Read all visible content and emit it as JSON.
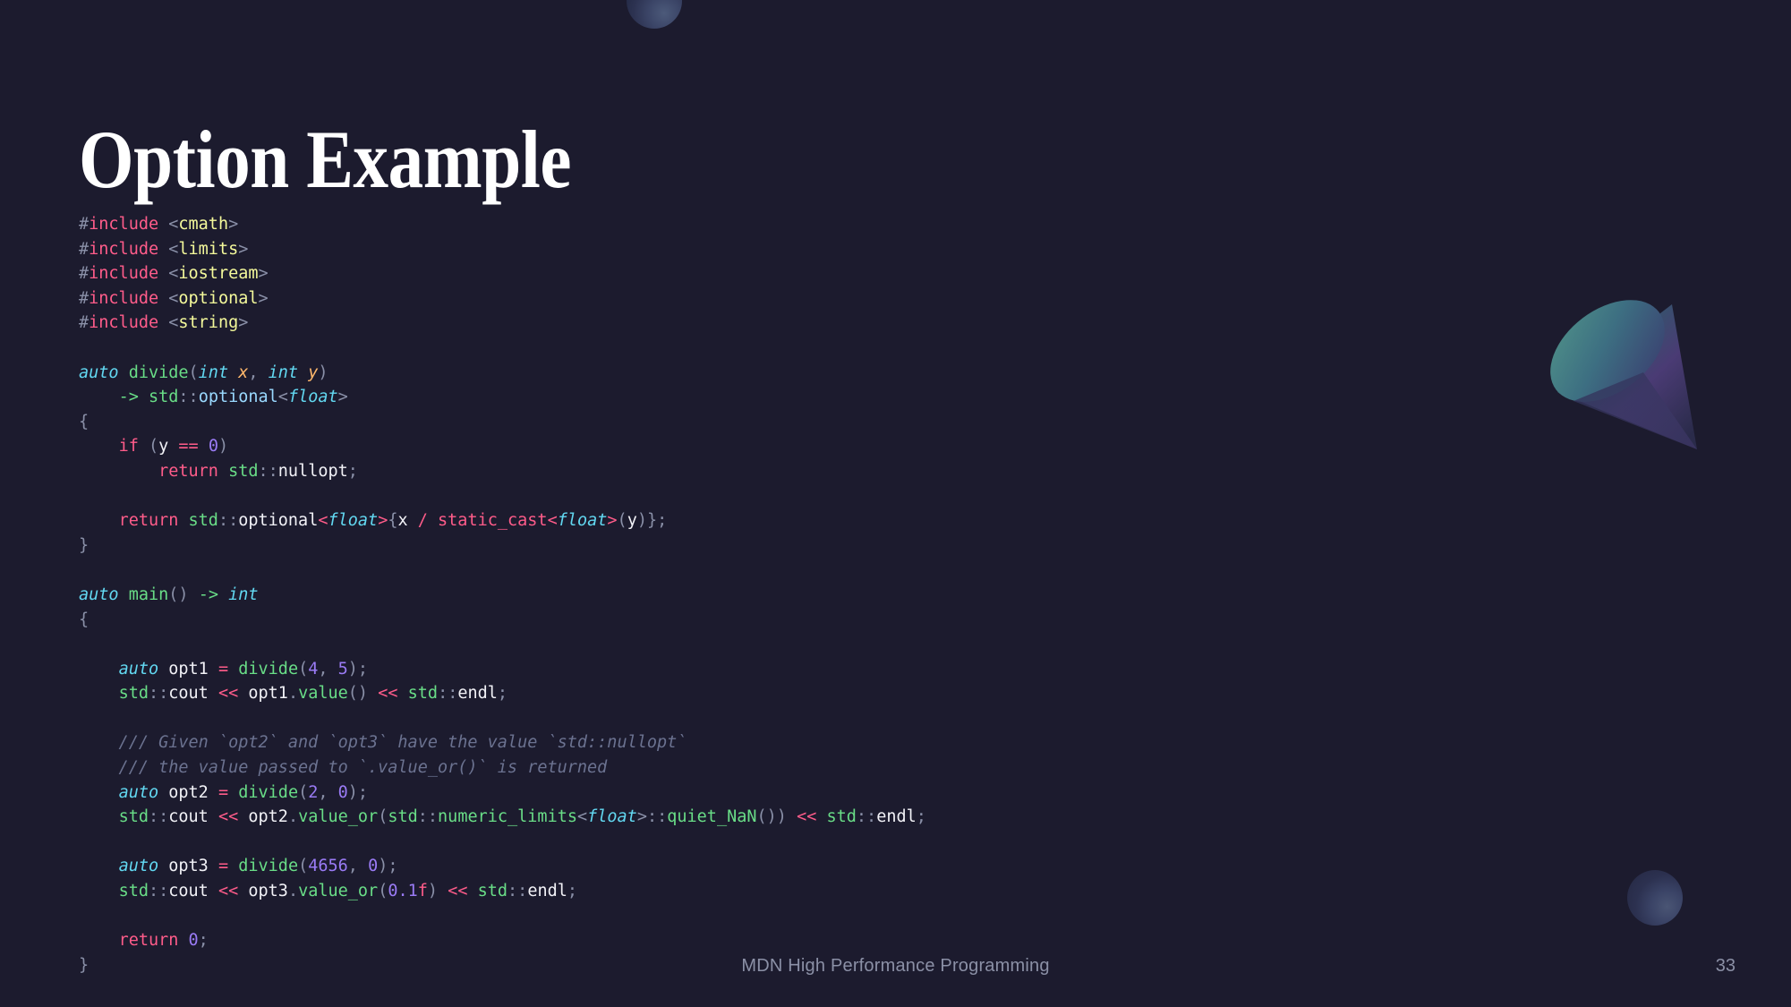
{
  "slide": {
    "title": "Option Example",
    "footer": "MDN High Performance Programming",
    "page_number": "33",
    "background_color": "#1c1b2e",
    "title_color": "#ffffff",
    "footer_color": "#8b90a6"
  },
  "decorations": [
    {
      "name": "sphere-top",
      "shape": "sphere"
    },
    {
      "name": "cone",
      "shape": "cone"
    },
    {
      "name": "sphere-bottom",
      "shape": "sphere"
    }
  ],
  "code": {
    "language": "cpp",
    "theme_colors": {
      "keyword": "#ff5c8a",
      "preprocessor_hash": "#8a90a8",
      "header_name": "#f4f99b",
      "type": "#62d8f1",
      "function": "#69dd87",
      "parameter": "#ffb86c",
      "identifier": "#f2f2f7",
      "number": "#9a7bf5",
      "comment": "#6b7290",
      "punctuation": "#a9afc4"
    },
    "text": "#include <cmath>\n#include <limits>\n#include <iostream>\n#include <optional>\n#include <string>\n\nauto divide(int x, int y)\n    -> std::optional<float>\n{\n    if (y == 0)\n        return std::nullopt;\n\n    return std::optional<float>{x / static_cast<float>(y)};\n}\n\nauto main() -> int\n{\n\n    auto opt1 = divide(4, 5);\n    std::cout << opt1.value() << std::endl;\n\n    /// Given `opt2` and `opt3` have the value `std::nullopt`\n    /// the value passed to `.value_or()` is returned\n    auto opt2 = divide(2, 0);\n    std::cout << opt2.value_or(std::numeric_limits<float>::quiet_NaN()) << std::endl;\n\n    auto opt3 = divide(4656, 0);\n    std::cout << opt3.value_or(0.1f) << std::endl;\n\n    return 0;\n}",
    "lines": [
      {
        "n": 1,
        "plain": "#include <cmath>"
      },
      {
        "n": 2,
        "plain": "#include <limits>"
      },
      {
        "n": 3,
        "plain": "#include <iostream>"
      },
      {
        "n": 4,
        "plain": "#include <optional>"
      },
      {
        "n": 5,
        "plain": "#include <string>"
      },
      {
        "n": 6,
        "plain": ""
      },
      {
        "n": 7,
        "plain": "auto divide(int x, int y)"
      },
      {
        "n": 8,
        "plain": "    -> std::optional<float>"
      },
      {
        "n": 9,
        "plain": "{"
      },
      {
        "n": 10,
        "plain": "    if (y == 0)"
      },
      {
        "n": 11,
        "plain": "        return std::nullopt;"
      },
      {
        "n": 12,
        "plain": ""
      },
      {
        "n": 13,
        "plain": "    return std::optional<float>{x / static_cast<float>(y)};"
      },
      {
        "n": 14,
        "plain": "}"
      },
      {
        "n": 15,
        "plain": ""
      },
      {
        "n": 16,
        "plain": "auto main() -> int"
      },
      {
        "n": 17,
        "plain": "{"
      },
      {
        "n": 18,
        "plain": ""
      },
      {
        "n": 19,
        "plain": "    auto opt1 = divide(4, 5);"
      },
      {
        "n": 20,
        "plain": "    std::cout << opt1.value() << std::endl;"
      },
      {
        "n": 21,
        "plain": ""
      },
      {
        "n": 22,
        "plain": "    /// Given `opt2` and `opt3` have the value `std::nullopt`"
      },
      {
        "n": 23,
        "plain": "    /// the value passed to `.value_or()` is returned"
      },
      {
        "n": 24,
        "plain": "    auto opt2 = divide(2, 0);"
      },
      {
        "n": 25,
        "plain": "    std::cout << opt2.value_or(std::numeric_limits<float>::quiet_NaN()) << std::endl;"
      },
      {
        "n": 26,
        "plain": ""
      },
      {
        "n": 27,
        "plain": "    auto opt3 = divide(4656, 0);"
      },
      {
        "n": 28,
        "plain": "    std::cout << opt3.value_or(0.1f) << std::endl;"
      },
      {
        "n": 29,
        "plain": ""
      },
      {
        "n": 30,
        "plain": "    return 0;"
      },
      {
        "n": 31,
        "plain": "}"
      }
    ],
    "tokens": [
      [
        [
          "#",
          "hash"
        ],
        [
          "include",
          "pink"
        ],
        [
          " ",
          "plain"
        ],
        [
          "<",
          "gray"
        ],
        [
          "cmath",
          "yellow"
        ],
        [
          ">",
          "gray"
        ]
      ],
      [
        [
          "#",
          "hash"
        ],
        [
          "include",
          "pink"
        ],
        [
          " ",
          "plain"
        ],
        [
          "<",
          "gray"
        ],
        [
          "limits",
          "yellow"
        ],
        [
          ">",
          "gray"
        ]
      ],
      [
        [
          "#",
          "hash"
        ],
        [
          "include",
          "pink"
        ],
        [
          " ",
          "plain"
        ],
        [
          "<",
          "gray"
        ],
        [
          "iostream",
          "yellow"
        ],
        [
          ">",
          "gray"
        ]
      ],
      [
        [
          "#",
          "hash"
        ],
        [
          "include",
          "pink"
        ],
        [
          " ",
          "plain"
        ],
        [
          "<",
          "gray"
        ],
        [
          "optional",
          "yellow"
        ],
        [
          ">",
          "gray"
        ]
      ],
      [
        [
          "#",
          "hash"
        ],
        [
          "include",
          "pink"
        ],
        [
          " ",
          "plain"
        ],
        [
          "<",
          "gray"
        ],
        [
          "string",
          "yellow"
        ],
        [
          ">",
          "gray"
        ]
      ],
      [],
      [
        [
          "auto",
          "cyan"
        ],
        [
          " ",
          "plain"
        ],
        [
          "divide",
          "green"
        ],
        [
          "(",
          "gray"
        ],
        [
          "int",
          "cyan"
        ],
        [
          " ",
          "plain"
        ],
        [
          "x",
          "orange"
        ],
        [
          ", ",
          "gray"
        ],
        [
          "int",
          "cyan"
        ],
        [
          " ",
          "plain"
        ],
        [
          "y",
          "orange"
        ],
        [
          ")",
          "gray"
        ]
      ],
      [
        [
          "    ",
          "plain"
        ],
        [
          "->",
          "green"
        ],
        [
          " ",
          "plain"
        ],
        [
          "std",
          "green"
        ],
        [
          "::",
          "gray"
        ],
        [
          "optional",
          "blue"
        ],
        [
          "<",
          "gray"
        ],
        [
          "float",
          "cyan"
        ],
        [
          ">",
          "gray"
        ]
      ],
      [
        [
          "{",
          "gray"
        ]
      ],
      [
        [
          "    ",
          "plain"
        ],
        [
          "if",
          "pink"
        ],
        [
          " ",
          "plain"
        ],
        [
          "(",
          "gray"
        ],
        [
          "y",
          "white"
        ],
        [
          " ",
          "plain"
        ],
        [
          "==",
          "pink"
        ],
        [
          " ",
          "plain"
        ],
        [
          "0",
          "purple"
        ],
        [
          ")",
          "gray"
        ]
      ],
      [
        [
          "        ",
          "plain"
        ],
        [
          "return",
          "pink"
        ],
        [
          " ",
          "plain"
        ],
        [
          "std",
          "green"
        ],
        [
          "::",
          "gray"
        ],
        [
          "nullopt",
          "white"
        ],
        [
          ";",
          "gray"
        ]
      ],
      [],
      [
        [
          "    ",
          "plain"
        ],
        [
          "return",
          "pink"
        ],
        [
          " ",
          "plain"
        ],
        [
          "std",
          "green"
        ],
        [
          "::",
          "gray"
        ],
        [
          "optional",
          "white"
        ],
        [
          "<",
          "pink"
        ],
        [
          "float",
          "cyan"
        ],
        [
          ">",
          "pink"
        ],
        [
          "{",
          "gray"
        ],
        [
          "x",
          "white"
        ],
        [
          " ",
          "plain"
        ],
        [
          "/",
          "pink"
        ],
        [
          " ",
          "plain"
        ],
        [
          "static_cast",
          "pink"
        ],
        [
          "<",
          "pink"
        ],
        [
          "float",
          "cyan"
        ],
        [
          ">",
          "pink"
        ],
        [
          "(",
          "gray"
        ],
        [
          "y",
          "white"
        ],
        [
          ")};",
          "gray"
        ]
      ],
      [
        [
          "}",
          "gray"
        ]
      ],
      [],
      [
        [
          "auto",
          "cyan"
        ],
        [
          " ",
          "plain"
        ],
        [
          "main",
          "green"
        ],
        [
          "()",
          "gray"
        ],
        [
          " ",
          "plain"
        ],
        [
          "->",
          "green"
        ],
        [
          " ",
          "plain"
        ],
        [
          "int",
          "cyan"
        ]
      ],
      [
        [
          "{",
          "gray"
        ]
      ],
      [],
      [
        [
          "    ",
          "plain"
        ],
        [
          "auto",
          "cyan"
        ],
        [
          " ",
          "plain"
        ],
        [
          "opt1",
          "white"
        ],
        [
          " ",
          "plain"
        ],
        [
          "=",
          "pink"
        ],
        [
          " ",
          "plain"
        ],
        [
          "divide",
          "green"
        ],
        [
          "(",
          "gray"
        ],
        [
          "4",
          "purple"
        ],
        [
          ", ",
          "gray"
        ],
        [
          "5",
          "purple"
        ],
        [
          ");",
          "gray"
        ]
      ],
      [
        [
          "    ",
          "plain"
        ],
        [
          "std",
          "green"
        ],
        [
          "::",
          "gray"
        ],
        [
          "cout",
          "white"
        ],
        [
          " ",
          "plain"
        ],
        [
          "<<",
          "pink"
        ],
        [
          " ",
          "plain"
        ],
        [
          "opt1",
          "white"
        ],
        [
          ".",
          "gray"
        ],
        [
          "value",
          "green"
        ],
        [
          "()",
          "gray"
        ],
        [
          " ",
          "plain"
        ],
        [
          "<<",
          "pink"
        ],
        [
          " ",
          "plain"
        ],
        [
          "std",
          "green"
        ],
        [
          "::",
          "gray"
        ],
        [
          "endl",
          "white"
        ],
        [
          ";",
          "gray"
        ]
      ],
      [],
      [
        [
          "    /// Given `opt2` and `opt3` have the value `std::nullopt`",
          "comment"
        ]
      ],
      [
        [
          "    /// the value passed to `.value_or()` is returned",
          "comment"
        ]
      ],
      [
        [
          "    ",
          "plain"
        ],
        [
          "auto",
          "cyan"
        ],
        [
          " ",
          "plain"
        ],
        [
          "opt2",
          "white"
        ],
        [
          " ",
          "plain"
        ],
        [
          "=",
          "pink"
        ],
        [
          " ",
          "plain"
        ],
        [
          "divide",
          "green"
        ],
        [
          "(",
          "gray"
        ],
        [
          "2",
          "purple"
        ],
        [
          ", ",
          "gray"
        ],
        [
          "0",
          "purple"
        ],
        [
          ");",
          "gray"
        ]
      ],
      [
        [
          "    ",
          "plain"
        ],
        [
          "std",
          "green"
        ],
        [
          "::",
          "gray"
        ],
        [
          "cout",
          "white"
        ],
        [
          " ",
          "plain"
        ],
        [
          "<<",
          "pink"
        ],
        [
          " ",
          "plain"
        ],
        [
          "opt2",
          "white"
        ],
        [
          ".",
          "gray"
        ],
        [
          "value_or",
          "green"
        ],
        [
          "(",
          "gray"
        ],
        [
          "std",
          "green"
        ],
        [
          "::",
          "gray"
        ],
        [
          "numeric_limits",
          "green"
        ],
        [
          "<",
          "gray"
        ],
        [
          "float",
          "cyan"
        ],
        [
          ">",
          "gray"
        ],
        [
          "::",
          "gray"
        ],
        [
          "quiet_NaN",
          "green"
        ],
        [
          "())",
          "gray"
        ],
        [
          " ",
          "plain"
        ],
        [
          "<<",
          "pink"
        ],
        [
          " ",
          "plain"
        ],
        [
          "std",
          "green"
        ],
        [
          "::",
          "gray"
        ],
        [
          "endl",
          "white"
        ],
        [
          ";",
          "gray"
        ]
      ],
      [],
      [
        [
          "    ",
          "plain"
        ],
        [
          "auto",
          "cyan"
        ],
        [
          " ",
          "plain"
        ],
        [
          "opt3",
          "white"
        ],
        [
          " ",
          "plain"
        ],
        [
          "=",
          "pink"
        ],
        [
          " ",
          "plain"
        ],
        [
          "divide",
          "green"
        ],
        [
          "(",
          "gray"
        ],
        [
          "4656",
          "purple"
        ],
        [
          ", ",
          "gray"
        ],
        [
          "0",
          "purple"
        ],
        [
          ");",
          "gray"
        ]
      ],
      [
        [
          "    ",
          "plain"
        ],
        [
          "std",
          "green"
        ],
        [
          "::",
          "gray"
        ],
        [
          "cout",
          "white"
        ],
        [
          " ",
          "plain"
        ],
        [
          "<<",
          "pink"
        ],
        [
          " ",
          "plain"
        ],
        [
          "opt3",
          "white"
        ],
        [
          ".",
          "gray"
        ],
        [
          "value_or",
          "green"
        ],
        [
          "(",
          "gray"
        ],
        [
          "0.1",
          "purple"
        ],
        [
          "f",
          "pink"
        ],
        [
          ")",
          "gray"
        ],
        [
          " ",
          "plain"
        ],
        [
          "<<",
          "pink"
        ],
        [
          " ",
          "plain"
        ],
        [
          "std",
          "green"
        ],
        [
          "::",
          "gray"
        ],
        [
          "endl",
          "white"
        ],
        [
          ";",
          "gray"
        ]
      ],
      [],
      [
        [
          "    ",
          "plain"
        ],
        [
          "return",
          "pink"
        ],
        [
          " ",
          "plain"
        ],
        [
          "0",
          "purple"
        ],
        [
          ";",
          "gray"
        ]
      ],
      [
        [
          "}",
          "gray"
        ]
      ]
    ]
  }
}
